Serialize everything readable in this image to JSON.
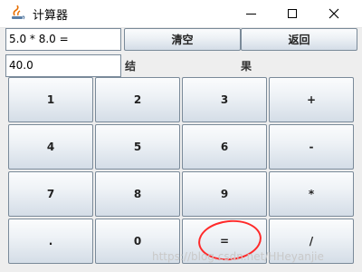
{
  "window": {
    "title": "计算器",
    "controls": {
      "minimize": "minimize-icon",
      "maximize": "maximize-icon",
      "close": "close-icon"
    }
  },
  "display": {
    "expression": "5.0 * 8.0 =",
    "result": "40.0",
    "result_label_left": "结",
    "result_label_right": "果"
  },
  "actions": {
    "clear_label": "清空",
    "back_label": "返回"
  },
  "keypad": {
    "rows": [
      [
        "1",
        "2",
        "3",
        "+"
      ],
      [
        "4",
        "5",
        "6",
        "-"
      ],
      [
        "7",
        "8",
        "9",
        "*"
      ],
      [
        ".",
        "0",
        "=",
        "/"
      ]
    ]
  },
  "overlay": {
    "watermark": "https://blog.csdn.net/HHeyanjie",
    "highlight_color": "#ff2a2a"
  }
}
